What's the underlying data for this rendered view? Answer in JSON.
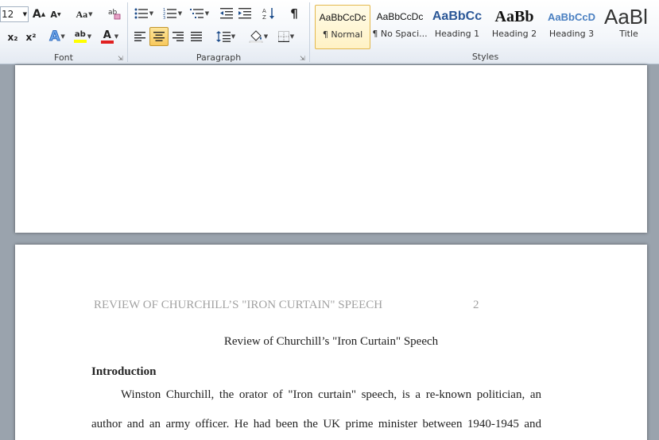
{
  "ribbon": {
    "font_group": {
      "label": "Font",
      "font_size": "12",
      "grow_font": "A",
      "shrink_font": "A",
      "change_case": "Aa",
      "subscript": "x₂",
      "superscript": "x²",
      "text_effects": "A",
      "highlight": "ab",
      "font_color": "A",
      "highlight_color": "#ffff00",
      "font_color_bar": "#e02020"
    },
    "paragraph_group": {
      "label": "Paragraph",
      "show_marks": "¶",
      "active_alignment": "center"
    },
    "styles_group": {
      "label": "Styles",
      "items": [
        {
          "preview": "AaBbCcDc",
          "name": "¶ Normal",
          "selected": true
        },
        {
          "preview": "AaBbCcDc",
          "name": "¶ No Spaci...",
          "selected": false
        },
        {
          "preview": "AaBbCc",
          "name": "Heading 1",
          "selected": false
        },
        {
          "preview": "AaBb",
          "name": "Heading 2",
          "selected": false
        },
        {
          "preview": "AaBbCcD",
          "name": "Heading 3",
          "selected": false
        },
        {
          "preview": "AaBl",
          "name": "Title",
          "selected": false
        }
      ]
    }
  },
  "document": {
    "page2": {
      "header": "REVIEW OF CHURCHILL’S \"IRON CURTAIN\" SPEECH",
      "page_number": "2",
      "title": "Review of Churchill’s \"Iron Curtain\" Speech",
      "heading": "Introduction",
      "lines": [
        "Winston Churchill, the orator of \"Iron curtain\" speech, is a re-known politician, an",
        "author and an army officer. He had been the UK prime minister between 1940-1945 and"
      ]
    }
  }
}
